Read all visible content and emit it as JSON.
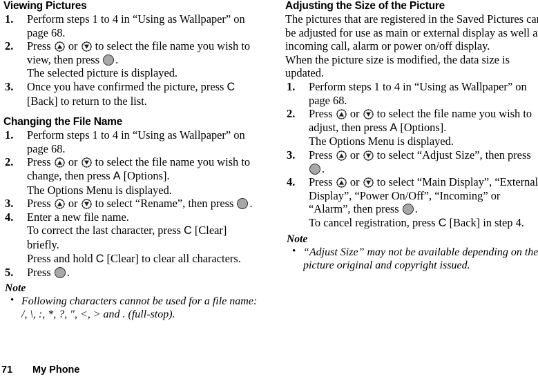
{
  "document": {
    "footer": {
      "page_number": "71",
      "chapter": "My Phone"
    }
  },
  "icons": {
    "nav_up": "nav-up-key-icon",
    "nav_down": "nav-down-key-icon",
    "center_select": "center-select-key-icon",
    "bullet": "•"
  },
  "softkeys": {
    "left_soft": "A",
    "clear_back": "C"
  },
  "left_column": {
    "section1": {
      "heading": "Viewing Pictures",
      "steps": [
        {
          "num": "1.",
          "parts": [
            {
              "type": "text",
              "value": "Perform steps 1 to 4 in “Using as Wallpaper” on page 68."
            }
          ]
        },
        {
          "num": "2.",
          "parts": [
            {
              "type": "text",
              "value": "Press "
            },
            {
              "type": "icon",
              "value": "nav_up"
            },
            {
              "type": "text",
              "value": " or "
            },
            {
              "type": "icon",
              "value": "nav_down"
            },
            {
              "type": "text",
              "value": " to select the file name you wish to view, then press "
            },
            {
              "type": "icon",
              "value": "center_select"
            },
            {
              "type": "text",
              "value": "."
            }
          ],
          "sub": [
            {
              "parts": [
                {
                  "type": "text",
                  "value": "The selected picture is displayed."
                }
              ]
            }
          ]
        },
        {
          "num": "3.",
          "parts": [
            {
              "type": "text",
              "value": "Once you have confirmed the picture, press "
            },
            {
              "type": "softkey",
              "value": "C"
            },
            {
              "type": "text",
              "value": " [Back] to return to the list."
            }
          ]
        }
      ]
    },
    "section2": {
      "heading": "Changing the File Name",
      "steps": [
        {
          "num": "1.",
          "parts": [
            {
              "type": "text",
              "value": "Perform steps 1 to 4 in “Using as Wallpaper” on page 68."
            }
          ]
        },
        {
          "num": "2.",
          "parts": [
            {
              "type": "text",
              "value": "Press "
            },
            {
              "type": "icon",
              "value": "nav_up"
            },
            {
              "type": "text",
              "value": " or "
            },
            {
              "type": "icon",
              "value": "nav_down"
            },
            {
              "type": "text",
              "value": " to select the file name you wish to change, then press "
            },
            {
              "type": "softkey",
              "value": "A"
            },
            {
              "type": "text",
              "value": " [Options]."
            }
          ],
          "sub": [
            {
              "parts": [
                {
                  "type": "text",
                  "value": "The Options Menu is displayed."
                }
              ]
            }
          ]
        },
        {
          "num": "3.",
          "parts": [
            {
              "type": "text",
              "value": "Press "
            },
            {
              "type": "icon",
              "value": "nav_up"
            },
            {
              "type": "text",
              "value": " or "
            },
            {
              "type": "icon",
              "value": "nav_down"
            },
            {
              "type": "text",
              "value": " to select “Rename”, then press "
            },
            {
              "type": "icon",
              "value": "center_select"
            },
            {
              "type": "text",
              "value": "."
            }
          ]
        },
        {
          "num": "4.",
          "parts": [
            {
              "type": "text",
              "value": "Enter a new file name."
            }
          ],
          "sub": [
            {
              "parts": [
                {
                  "type": "text",
                  "value": "To correct the last character, press "
                },
                {
                  "type": "softkey",
                  "value": "C"
                },
                {
                  "type": "text",
                  "value": " [Clear] briefly."
                }
              ]
            },
            {
              "parts": [
                {
                  "type": "text",
                  "value": "Press and hold "
                },
                {
                  "type": "softkey",
                  "value": "C"
                },
                {
                  "type": "text",
                  "value": " [Clear] to clear all characters."
                }
              ]
            }
          ]
        },
        {
          "num": "5.",
          "parts": [
            {
              "type": "text",
              "value": "Press "
            },
            {
              "type": "icon",
              "value": "center_select"
            },
            {
              "type": "text",
              "value": "."
            }
          ]
        }
      ],
      "note": {
        "title": "Note",
        "items": [
          "Following characters cannot be used for a file name: /, \\, :, *, ?, \", <, > and . (full-stop)."
        ]
      }
    }
  },
  "right_column": {
    "section1": {
      "heading": "Adjusting the Size of the Picture",
      "paragraphs": [
        "The pictures that are registered in the Saved Pictures can be adjusted for use as main or external display as well as incoming call, alarm or power on/off display.",
        "When the picture size is modified, the data size is updated."
      ],
      "steps": [
        {
          "num": "1.",
          "parts": [
            {
              "type": "text",
              "value": "Perform steps 1 to 4 in “Using as Wallpaper” on page 68."
            }
          ]
        },
        {
          "num": "2.",
          "parts": [
            {
              "type": "text",
              "value": "Press "
            },
            {
              "type": "icon",
              "value": "nav_up"
            },
            {
              "type": "text",
              "value": " or "
            },
            {
              "type": "icon",
              "value": "nav_down"
            },
            {
              "type": "text",
              "value": " to select the file name you wish to adjust, then press "
            },
            {
              "type": "softkey",
              "value": "A"
            },
            {
              "type": "text",
              "value": " [Options]."
            }
          ],
          "sub": [
            {
              "parts": [
                {
                  "type": "text",
                  "value": "The Options Menu is displayed."
                }
              ]
            }
          ]
        },
        {
          "num": "3.",
          "parts": [
            {
              "type": "text",
              "value": "Press "
            },
            {
              "type": "icon",
              "value": "nav_up"
            },
            {
              "type": "text",
              "value": " or "
            },
            {
              "type": "icon",
              "value": "nav_down"
            },
            {
              "type": "text",
              "value": " to select “Adjust Size”, then press "
            },
            {
              "type": "icon",
              "value": "center_select"
            },
            {
              "type": "text",
              "value": "."
            }
          ]
        },
        {
          "num": "4.",
          "parts": [
            {
              "type": "text",
              "value": "Press "
            },
            {
              "type": "icon",
              "value": "nav_up"
            },
            {
              "type": "text",
              "value": " or "
            },
            {
              "type": "icon",
              "value": "nav_down"
            },
            {
              "type": "text",
              "value": " to select “Main Display”, “External Display”, “Power On/Off”, “Incoming” or “Alarm”, then press "
            },
            {
              "type": "icon",
              "value": "center_select"
            },
            {
              "type": "text",
              "value": "."
            }
          ],
          "sub": [
            {
              "parts": [
                {
                  "type": "text",
                  "value": "To cancel registration, press "
                },
                {
                  "type": "softkey",
                  "value": "C"
                },
                {
                  "type": "text",
                  "value": " [Back] in step 4."
                }
              ]
            }
          ]
        }
      ],
      "note": {
        "title": "Note",
        "items": [
          "“Adjust Size” may not be available depending on the picture original and copyright issued."
        ]
      }
    }
  }
}
